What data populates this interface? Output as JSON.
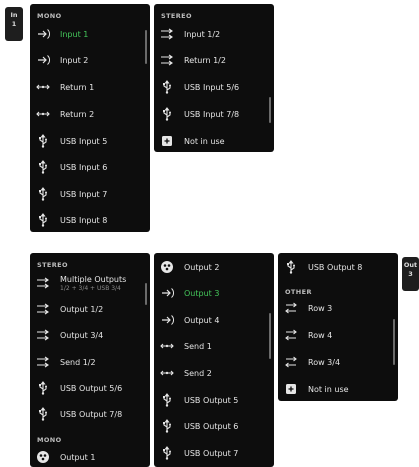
{
  "top": {
    "badge": {
      "label": "In",
      "number": "1"
    },
    "mono": {
      "heading": "MONO",
      "items": [
        {
          "label": "Input 1",
          "icon": "input-arrow-icon",
          "active": true
        },
        {
          "label": "Input 2",
          "icon": "input-arrow-icon"
        },
        {
          "label": "Return 1",
          "icon": "return-arrows-icon"
        },
        {
          "label": "Return 2",
          "icon": "return-arrows-icon"
        },
        {
          "label": "USB Input 5",
          "icon": "usb-icon"
        },
        {
          "label": "USB Input 6",
          "icon": "usb-icon"
        },
        {
          "label": "USB Input 7",
          "icon": "usb-icon"
        },
        {
          "label": "USB Input 8",
          "icon": "usb-icon"
        }
      ]
    },
    "stereo": {
      "heading": "STEREO",
      "items": [
        {
          "label": "Input 1/2",
          "icon": "stereo-arrows-icon"
        },
        {
          "label": "Return 1/2",
          "icon": "stereo-arrows-icon"
        },
        {
          "label": "USB Input 5/6",
          "icon": "usb-icon"
        },
        {
          "label": "USB Input 7/8",
          "icon": "usb-icon"
        },
        {
          "label": "Not in use",
          "icon": "plus-box-icon"
        }
      ]
    }
  },
  "bottom": {
    "badge": {
      "label": "Out",
      "number": "3"
    },
    "col1": {
      "heading_stereo": "STEREO",
      "items": [
        {
          "label": "Multiple Outputs",
          "sub": "1/2 + 3/4 + USB 3/4",
          "icon": "stereo-arrows-icon"
        },
        {
          "label": "Output 1/2",
          "icon": "stereo-arrows-icon"
        },
        {
          "label": "Output 3/4",
          "icon": "stereo-arrows-icon"
        },
        {
          "label": "Send 1/2",
          "icon": "stereo-arrows-icon"
        },
        {
          "label": "USB Output 5/6",
          "icon": "usb-icon"
        },
        {
          "label": "USB Output 7/8",
          "icon": "usb-icon"
        }
      ],
      "heading_mono": "MONO",
      "mono_items": [
        {
          "label": "Output 1",
          "icon": "speaker-icon"
        }
      ]
    },
    "col2": {
      "items": [
        {
          "label": "Output 2",
          "icon": "speaker-icon"
        },
        {
          "label": "Output 3",
          "icon": "output-arrow-icon",
          "active": true
        },
        {
          "label": "Output 4",
          "icon": "output-arrow-icon"
        },
        {
          "label": "Send 1",
          "icon": "return-arrows-icon"
        },
        {
          "label": "Send 2",
          "icon": "return-arrows-icon"
        },
        {
          "label": "USB Output 5",
          "icon": "usb-icon"
        },
        {
          "label": "USB Output 6",
          "icon": "usb-icon"
        },
        {
          "label": "USB Output 7",
          "icon": "usb-icon"
        }
      ]
    },
    "col3": {
      "top_items": [
        {
          "label": "USB Output 8",
          "icon": "usb-icon"
        }
      ],
      "heading_other": "OTHER",
      "items": [
        {
          "label": "Row 3",
          "icon": "loop-arrows-icon"
        },
        {
          "label": "Row 4",
          "icon": "loop-arrows-icon"
        },
        {
          "label": "Row 3/4",
          "icon": "loop-arrows-icon"
        },
        {
          "label": "Not in use",
          "icon": "plus-box-icon"
        }
      ]
    }
  },
  "colors": {
    "active": "#44c65a",
    "panel": "#0d0d0d",
    "text": "#e6e6e6"
  }
}
